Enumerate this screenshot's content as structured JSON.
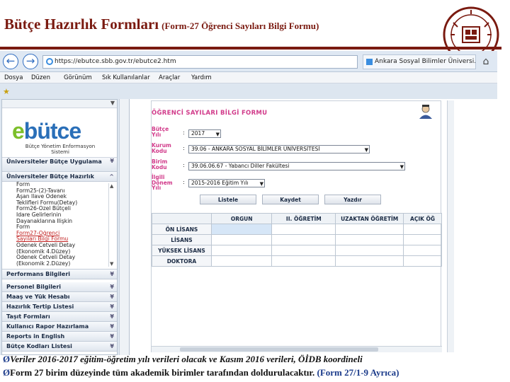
{
  "slide": {
    "title_main": "Bütçe Hazırlık Formları",
    "title_sub": "(Form-27 Öğrenci Sayıları Bilgi Formu)",
    "colors": {
      "title": "#7a1a10",
      "form_labels": "#d13a8a",
      "footer_bullet": "#1a3a8a"
    },
    "footer": [
      {
        "bullet": "Ø",
        "text": "Veriler 2016-2017 eğitim-öğretim yılı verileri olacak ve Kasım 2016 verileri, ÖİDB koordineli"
      },
      {
        "bullet": "Ø",
        "text": "Form 27 birim düzeyinde tüm akademik birimler tarafından doldurulacaktır.",
        "note": "(Form 27/1-9 Ayrıca)"
      }
    ]
  },
  "browser": {
    "url": "https://ebutce.sbb.gov.tr/ebutce2.htm",
    "tab_title": "Ankara Sosyal Bilimler Üniversi...",
    "menu": [
      "Dosya",
      "Düzen",
      "Görünüm",
      "Sık Kullanılanlar",
      "Araçlar",
      "Yardım"
    ]
  },
  "sidebar": {
    "logo_text_e": "e",
    "logo_text_rest": "bütce",
    "logo_tagline": "Bütçe Yönetim Enformasyon Sistemi",
    "items_top": [
      "Üniversiteler Bütçe Uygulama",
      "Üniversiteler Bütçe Hazırlık"
    ],
    "sub_items": [
      "Form",
      "Form25-(2)-Tavanı",
      "Aşan İlave Ödenek",
      "Teklifleri Formu(Detay)",
      "Form26-Özel Bütçeli",
      "İdare Gelirlerinin",
      "Dayanaklarına İlişkin",
      "Form",
      "Form27-Öğrenci",
      "Sayıları Bilgi Formu",
      "Ödenek Cetveli Detay",
      "(Ekonomik 4.Düzey)",
      "Ödenek Cetveli Detay",
      "(Ekonomik 2.Düzey)"
    ],
    "items_bottom": [
      "Performans Bilgileri",
      "Personel Bilgileri",
      "Maaş ve Yük Hesabı",
      "Hazırlık Tertip Listesi",
      "Taşıt Formları",
      "Kullanıcı Rapor Hazırlama",
      "Reports in English",
      "Bütçe Kodları Listesi"
    ]
  },
  "form": {
    "title": "ÖĞRENCİ SAYILARI BİLGİ FORMU",
    "fields": [
      {
        "label": "Bütçe Yılı",
        "value": "2017"
      },
      {
        "label": "Kurum Kodu",
        "value": "39.06 - ANKARA SOSYAL BİLİMLER ÜNİVERSİTESİ"
      },
      {
        "label": "Birim Kodu",
        "value": "39.06.06.67 - Yabancı Diller Fakültesi"
      },
      {
        "label": "İlgili Dönem Yılı",
        "value": "2015-2016 Eğitim Yılı"
      }
    ],
    "buttons": [
      "Listele",
      "Kaydet",
      "Yazdır"
    ],
    "table": {
      "headers": [
        "",
        "ORGUN",
        "II. ÖĞRETİM",
        "UZAKTAN ÖĞRETİM",
        "AÇIK ÖĞ"
      ],
      "rows": [
        "ÖN LİSANS",
        "LİSANS",
        "YÜKSEK LİSANS",
        "DOKTORA"
      ]
    }
  }
}
